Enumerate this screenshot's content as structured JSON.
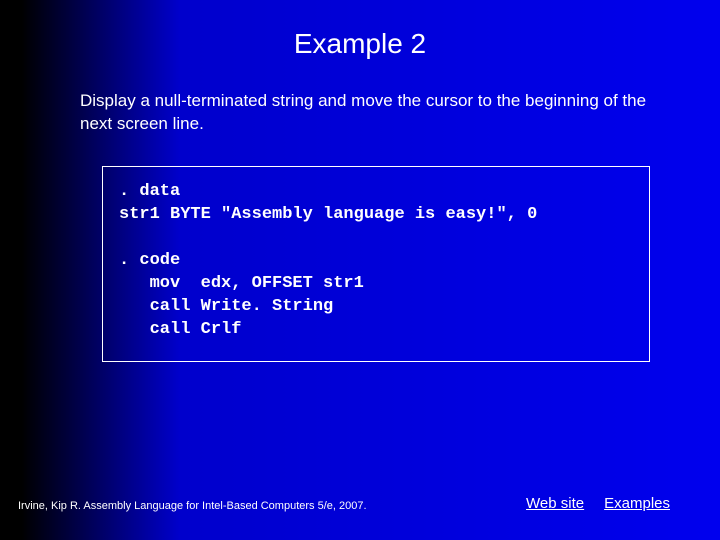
{
  "title": "Example 2",
  "description": "Display a null-terminated string and move the cursor to the beginning of the next screen line.",
  "code": ". data\nstr1 BYTE \"Assembly language is easy!\", 0\n\n. code\n   mov  edx, OFFSET str1\n   call Write. String\n   call Crlf",
  "footer_citation": "Irvine, Kip R. Assembly Language for Intel-Based Computers 5/e, 2007.",
  "links": {
    "website": "Web site",
    "examples": "Examples"
  }
}
